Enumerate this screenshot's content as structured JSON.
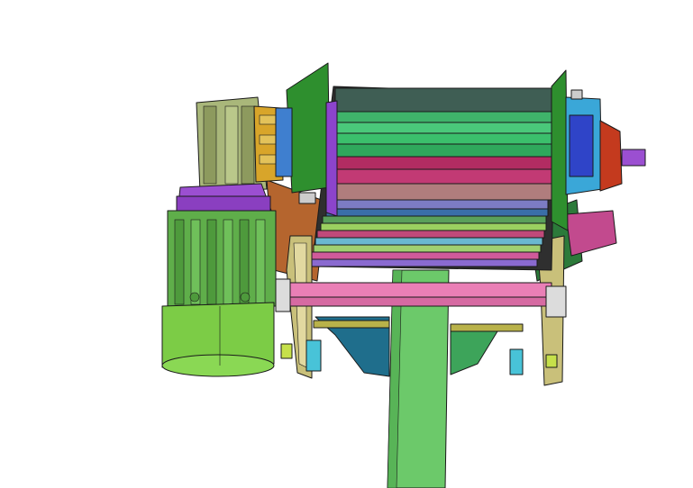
{
  "scene": {
    "kind": "cad-3d-model-view",
    "background": "#ffffff",
    "parts": [
      {
        "name": "gear-reducer",
        "color": "#a9b77a"
      },
      {
        "name": "motor-flange",
        "color": "#9b4fd1"
      },
      {
        "name": "drive-motor",
        "color": "#5fae4a"
      },
      {
        "name": "motor-end-cap",
        "color": "#7ccc46"
      },
      {
        "name": "drum-roller-bank",
        "color": "#3fb36a"
      },
      {
        "name": "left-side-plate",
        "color": "#2e8f2e"
      },
      {
        "name": "right-bearing-housing",
        "color": "#3aa7d8"
      },
      {
        "name": "shaft-end",
        "color": "#c43a1e"
      },
      {
        "name": "pink-tie-rod",
        "color": "#ea7fb6"
      },
      {
        "name": "support-column",
        "color": "#6cc96a"
      },
      {
        "name": "mounting-bracket",
        "color": "#1f6e8c"
      },
      {
        "name": "side-mount-plate",
        "color": "#c24a8e"
      }
    ]
  }
}
